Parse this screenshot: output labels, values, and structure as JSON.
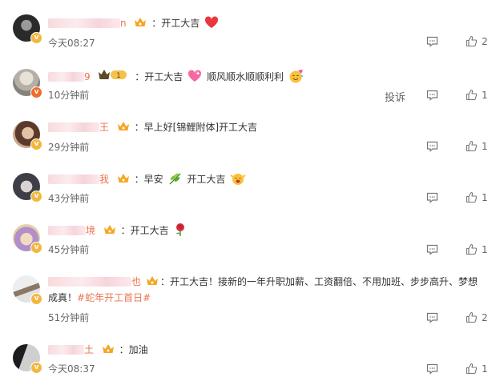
{
  "comments": [
    {
      "name_tail": "n",
      "text": "：开工大吉",
      "time": "今天08:27",
      "likes": "2",
      "avatar_colors": [
        "#2a2a2a",
        "#8a8a8a"
      ],
      "badge": "gold"
    },
    {
      "name_tail": "9",
      "text": "：开工大吉",
      "text2": "顺风顺水顺顺利利",
      "time": "10分钟前",
      "likes": "1",
      "report": "投诉",
      "crown_level": "1",
      "avatar_colors": [
        "#a9a9a1",
        "#e3ddd3"
      ],
      "badge": "orange"
    },
    {
      "name_tail": "王",
      "text": "：早上好[锦鲤附体]开工大吉",
      "time": "29分钟前",
      "likes": "1",
      "avatar_colors": [
        "#6a4b3c",
        "#d9b59c"
      ],
      "badge": "gold"
    },
    {
      "name_tail": "我",
      "text": "：早安",
      "text2": "开工大吉",
      "time": "43分钟前",
      "likes": "1",
      "avatar_colors": [
        "#3e3e46",
        "#c8c2c2"
      ],
      "badge": "gold"
    },
    {
      "name_tail": "境",
      "text": "：开工大吉",
      "time": "45分钟前",
      "likes": "1",
      "avatar_colors": [
        "#b28fc9",
        "#e8d7b6"
      ],
      "badge": "gold"
    },
    {
      "name_tail": "也",
      "text": "：开工大吉！接新的一年升职加薪、工资翻倍、不用加班、步步高升、梦想成真！",
      "hashtag": "#蛇年开工首日#",
      "time": "51分钟前",
      "likes": "2",
      "avatar_colors": [
        "#dcdcdc",
        "#7a6a5a"
      ],
      "badge": "gold"
    },
    {
      "name_tail": "土",
      "text": "：加油",
      "time": "今天08:37",
      "likes": "1",
      "avatar_colors": [
        "#1d1d1d",
        "#bfbfbf"
      ],
      "badge": "gold"
    }
  ],
  "icons": {
    "reply": "comment-icon",
    "like": "thumbs-up-icon",
    "vip": "crown-icon"
  },
  "colors": {
    "username": "#eb7350",
    "text": "#333333",
    "meta": "#666666"
  }
}
